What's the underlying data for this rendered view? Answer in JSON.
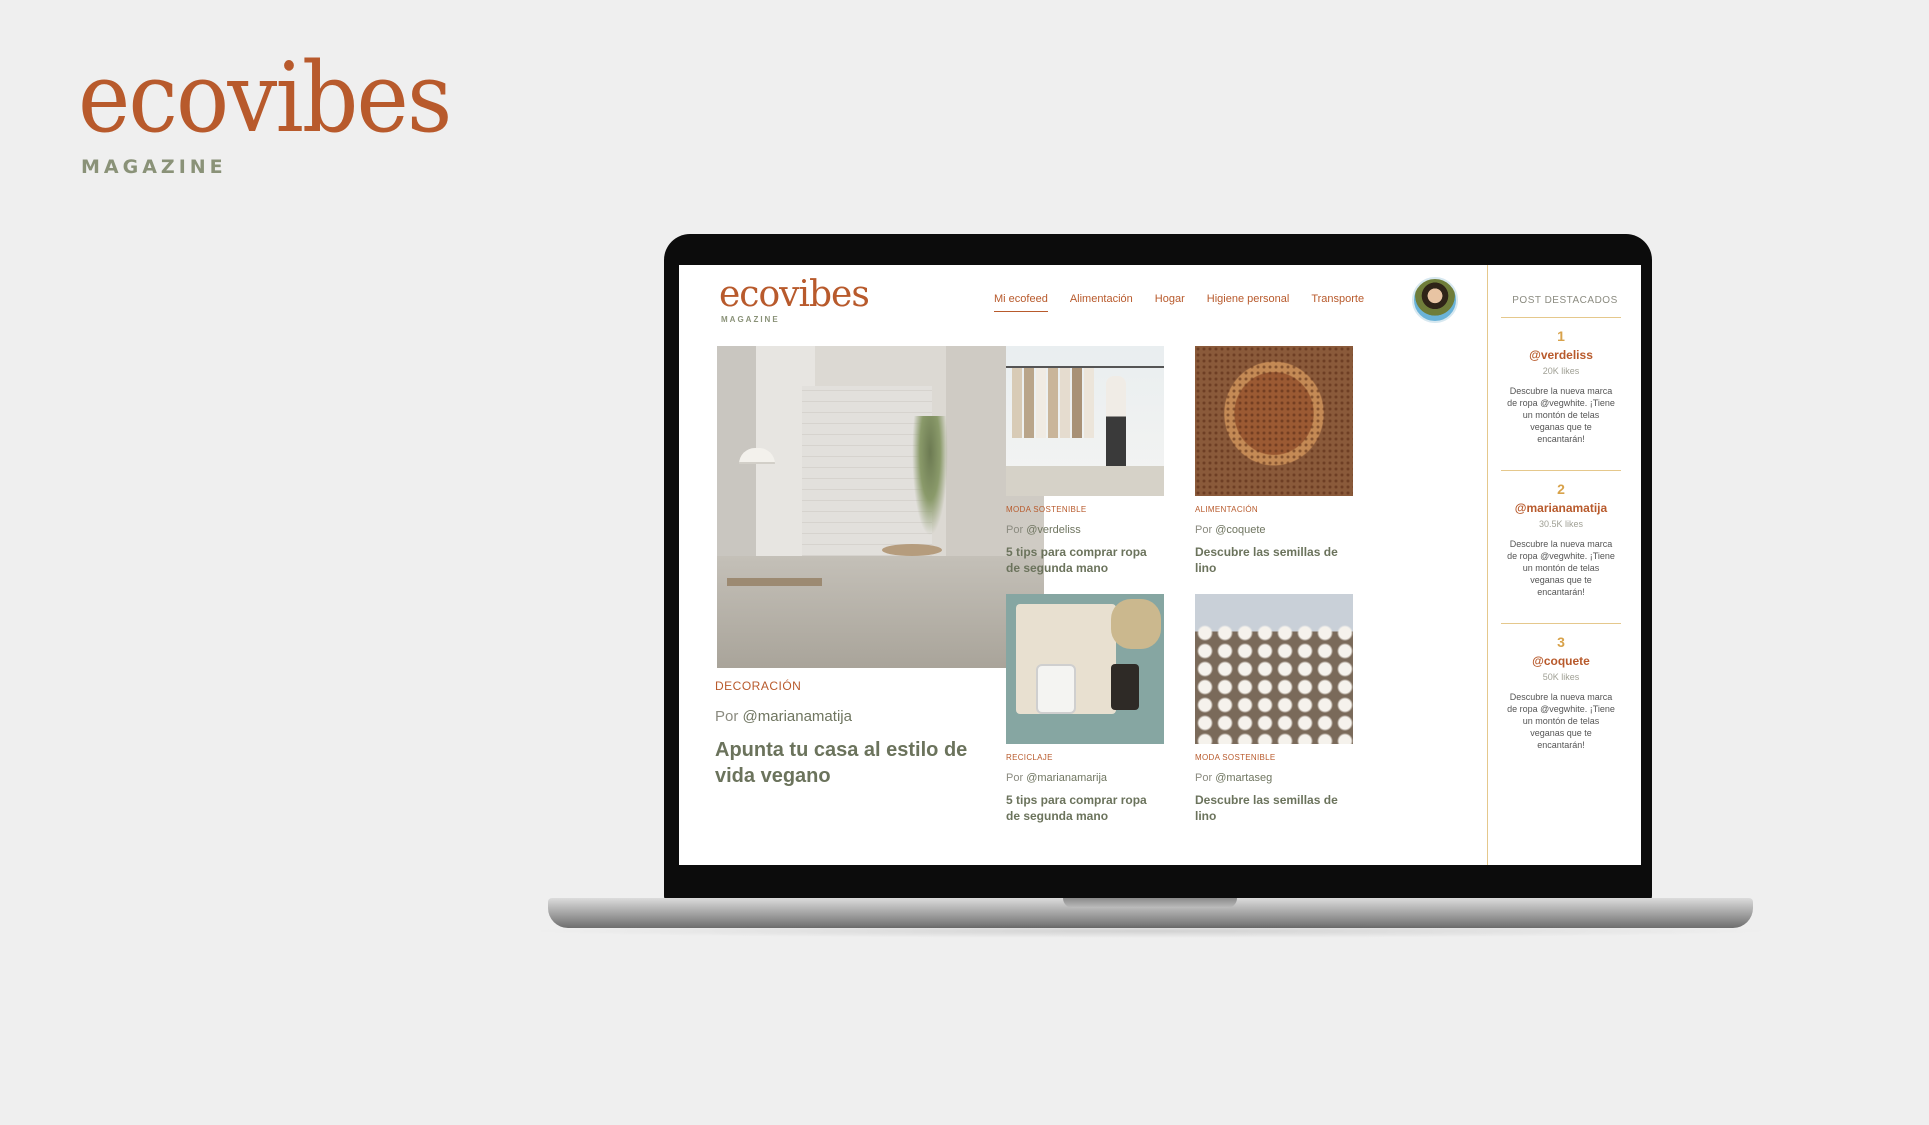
{
  "brand": {
    "word": "ecovibes",
    "sub": "MAGAZINE"
  },
  "site": {
    "logo_word": "ecovibes",
    "logo_sub": "MAGAZINE",
    "nav": [
      "Mi ecofeed",
      "Alimentación",
      "Hogar",
      "Higiene personal",
      "Transporte"
    ],
    "active_nav": "Mi ecofeed"
  },
  "featured": {
    "category": "DECORACIÓN",
    "by_prefix": "Por",
    "author": "@marianamatija",
    "title": "Apunta tu casa al estilo de vida vegano"
  },
  "cards": [
    {
      "category": "MODA SOSTENIBLE",
      "by_prefix": "Por",
      "author": "@verdeliss",
      "title": "5 tips para comprar ropa de segunda mano"
    },
    {
      "category": "ALIMENTACIÓN",
      "by_prefix": "Por",
      "author": "@coquete",
      "title": "Descubre las semillas de lino"
    },
    {
      "category": "RECICLAJE",
      "by_prefix": "Por",
      "author": "@marianamarija",
      "title": "5 tips para comprar ropa de segunda mano"
    },
    {
      "category": "MODA SOSTENIBLE",
      "by_prefix": "Por",
      "author": "@martaseg",
      "title": "Descubre las semillas de lino"
    }
  ],
  "sidebar": {
    "heading": "POST DESTACADOS",
    "items": [
      {
        "rank": "1",
        "user": "@verdeliss",
        "likes": "20K likes",
        "desc": "Descubre la nueva marca de ropa @vegwhite. ¡Tiene un montón de telas veganas que te encantarán!"
      },
      {
        "rank": "2",
        "user": "@marianamatija",
        "likes": "30.5K likes",
        "desc": "Descubre la nueva marca de ropa @vegwhite. ¡Tiene un montón de telas veganas que te encantarán!"
      },
      {
        "rank": "3",
        "user": "@coquete",
        "likes": "50K likes",
        "desc": "Descubre la nueva marca de ropa @vegwhite. ¡Tiene un montón de telas veganas que te encantarán!"
      }
    ]
  },
  "colors": {
    "accent": "#b85a2c",
    "olive": "#6b735c",
    "gold": "#d8a24a",
    "background": "#efefef"
  }
}
